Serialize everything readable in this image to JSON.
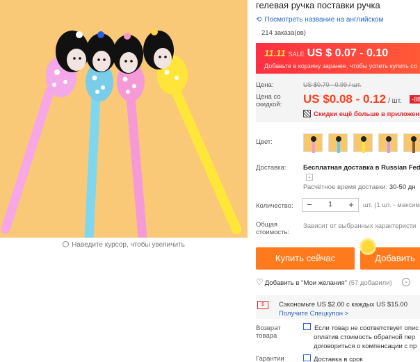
{
  "product": {
    "title": "гелевая ручка поставки ручка",
    "translate_link": "Посмотреть название на английском",
    "orders": "214 заказа(ов)"
  },
  "image": {
    "zoom_hint": "Наведите курсор, чтобы увеличить"
  },
  "promo": {
    "event": "11.11",
    "sale_label": "SALE",
    "range": "US $ 0.07 - 0.10",
    "note": "Добавьте в корзину заранее, чтобы успеть купить со"
  },
  "price": {
    "label": "Цена:",
    "old": "US $0.70 - 0.99 / шт.",
    "discount_label": "Цена со скидкой:",
    "new": "US $0.08 - 0.12",
    "unit": "/ шт.",
    "badge": "-88",
    "app_promo": "Скидки ещё больше в приложении"
  },
  "color": {
    "label": "Цвет:",
    "swatches": [
      {
        "name": "pink",
        "color": "#f59ad7"
      },
      {
        "name": "blue",
        "color": "#66c8ee"
      },
      {
        "name": "yellow",
        "color": "#ffe53a"
      },
      {
        "name": "purple",
        "color": "#c9a0f0"
      },
      {
        "name": "mixed",
        "color": "#8a5b3a"
      }
    ]
  },
  "shipping": {
    "label": "Доставка:",
    "method": "Бесплатная доставка в Russian Fed",
    "eta_label": "Расчётное время доставки:",
    "eta": "30-50 дн"
  },
  "quantity": {
    "label": "Количество:",
    "minus": "−",
    "value": "1",
    "plus": "+",
    "note": "шт. (1 шт. - максим"
  },
  "total": {
    "label": "Общая стоимость:",
    "note": "Зависит от выбранных характеристи"
  },
  "actions": {
    "buy_now": "Купить сейчас",
    "add_cart": "Добавить"
  },
  "wishlist": {
    "label": "Добавить в \"Мои желания\"",
    "count": "(57 добавили)"
  },
  "coupon": {
    "save": "Сэкономьте US $2.00 с каждых US $15.00",
    "get": "Получите Спецкупон >"
  },
  "returns": {
    "label": "Возврат товара",
    "line1": "Если товар не соответствует опис",
    "line2": "оплатив стоимость обратной пер",
    "line3": "договориться о компенсации с пр"
  },
  "guarantee": {
    "label": "Гарантии",
    "value": "Доставка в срок"
  },
  "colors": {
    "accent": "#ff7a1c",
    "price": "#ff3f1c",
    "link": "#2966c9"
  }
}
